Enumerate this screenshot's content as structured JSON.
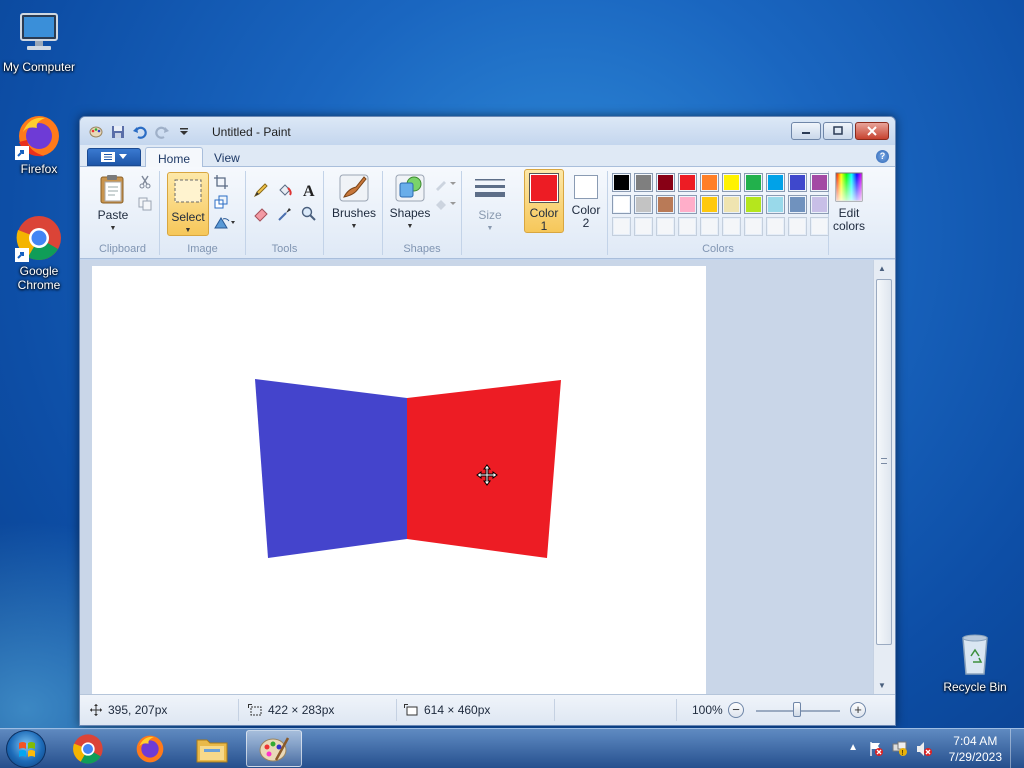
{
  "desktop": {
    "icons": [
      {
        "label": "My Computer",
        "icon": "computer-icon"
      },
      {
        "label": "Firefox",
        "icon": "firefox-icon"
      },
      {
        "label": "Google Chrome",
        "icon": "chrome-icon"
      },
      {
        "label": "Recycle Bin",
        "icon": "recycle-bin-icon"
      }
    ]
  },
  "window": {
    "title": "Untitled - Paint",
    "tabs": [
      "Home",
      "View"
    ],
    "active_tab": "Home"
  },
  "ribbon": {
    "clipboard": {
      "label": "Clipboard",
      "paste": "Paste"
    },
    "image": {
      "label": "Image",
      "select": "Select"
    },
    "tools": {
      "label": "Tools"
    },
    "brushes": "Brushes",
    "shapes": {
      "label": "Shapes",
      "button": "Shapes"
    },
    "size": "Size",
    "color1": {
      "line1": "Color",
      "line2": "1",
      "value": "#ed1c24"
    },
    "color2": {
      "line1": "Color",
      "line2": "2",
      "value": "#ffffff"
    },
    "colors_label": "Colors",
    "edit_colors": {
      "line1": "Edit",
      "line2": "colors"
    },
    "palette_row1": [
      "#000000",
      "#7f7f7f",
      "#880015",
      "#ed1c24",
      "#ff7f27",
      "#fff200",
      "#22b14c",
      "#00a2e8",
      "#3f48cc",
      "#a349a4"
    ],
    "palette_row2": [
      "#ffffff",
      "#c3c3c3",
      "#b97a57",
      "#ffaec9",
      "#ffc90e",
      "#efe4b0",
      "#b5e61d",
      "#99d9ea",
      "#7092be",
      "#c8bfe7"
    ],
    "palette_row3": [
      "",
      "",
      "",
      "",
      "",
      "",
      "",
      "",
      "",
      ""
    ]
  },
  "canvas": {
    "left_shape_color": "#4444cc",
    "right_shape_color": "#ed1c24"
  },
  "status": {
    "cursor": "395, 207px",
    "selection": "422 × 283px",
    "image_size": "614 × 460px",
    "zoom": "100%",
    "zoom_level": 1.0
  },
  "taskbar": {
    "apps": [
      "chrome",
      "firefox",
      "file-explorer",
      "paint"
    ],
    "time": "7:04 AM",
    "date": "7/29/2023"
  }
}
